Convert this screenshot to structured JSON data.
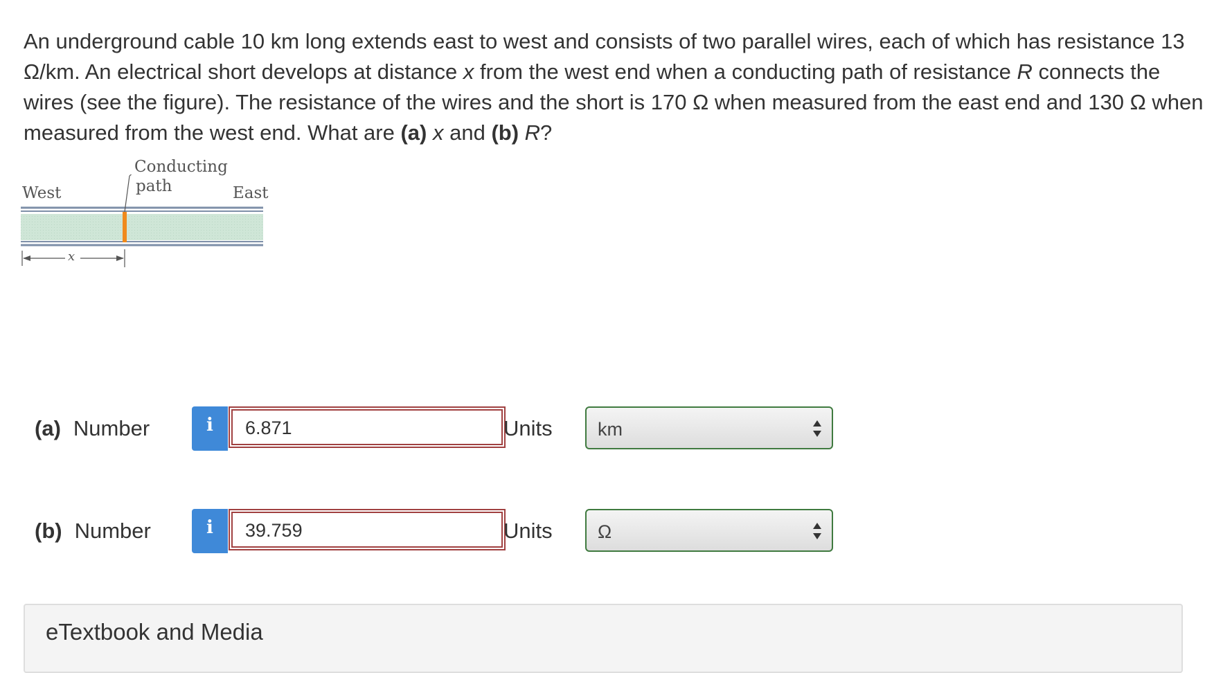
{
  "question": {
    "line1_before_x": "An underground cable 10 km long extends east to west and consists of two parallel wires, each of which has resistance 13 Ω/km. An electrical short develops at distance ",
    "var_x": "x",
    "line_mid": " from the west end when a conducting path of resistance ",
    "var_R": "R",
    "line_after_R": " connects the wires (see the figure). The resistance of the wires and the short is 170 Ω when measured from the east end and 130 Ω when measured from the west end. What are ",
    "part_a_label": "(a)",
    "part_a_var": "x",
    "and_text": " and ",
    "part_b_label": "(b)",
    "part_b_var": "R",
    "end": "?"
  },
  "figure": {
    "label_conducting": "Conducting",
    "label_path": "path",
    "label_west": "West",
    "label_east": "East",
    "label_x": "x"
  },
  "answers": [
    {
      "part": "(a)",
      "number_label": "Number",
      "info": "i",
      "value": "6.871",
      "units_label": "Units",
      "unit": "km"
    },
    {
      "part": "(b)",
      "number_label": "Number",
      "info": "i",
      "value": "39.759",
      "units_label": "Units",
      "unit": "Ω"
    }
  ],
  "media": {
    "title": "eTextbook and Media"
  },
  "colors": {
    "info_button": "#3f89d8",
    "answer_border": "#a04040",
    "select_border": "#3f7a3f",
    "short_path": "#f08a1c"
  }
}
